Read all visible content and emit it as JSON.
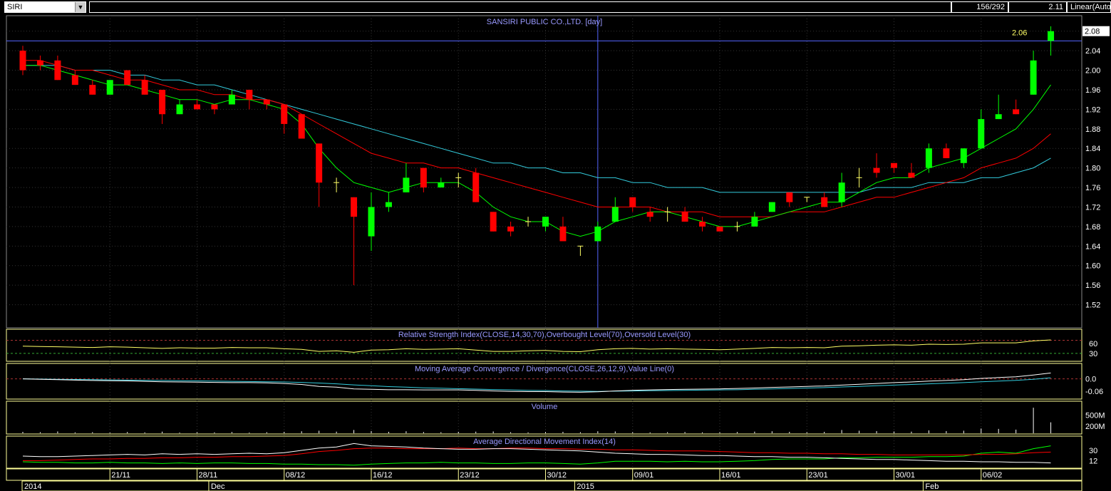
{
  "toolbar": {
    "symbol": "SIRI",
    "dropdown_glyph": "▼",
    "bar_counter": "156/292",
    "last_value": "2.11",
    "scale_mode": "Linear(Auto"
  },
  "colors": {
    "background": "#000000",
    "bull_candle": "#00ff00",
    "bear_candle": "#ff0000",
    "ma_short": "#00ff00",
    "ma_mid": "#ff0000",
    "ma_long": "#33ccdd",
    "crosshair": "#5566ff",
    "panel_border": "#ffff99",
    "rsi_line": "#ffff66",
    "macd_line": "#ffffff",
    "signal_line": "#33ccdd",
    "adx_line": "#ffffff",
    "dmi_plus": "#00ff00",
    "dmi_minus": "#ff0000"
  },
  "chart_data": [
    {
      "type": "candlestick",
      "title": "SANSIRI PUBLIC CO.,LTD. [day]",
      "crosshair_value": "2.06",
      "last_price_tag": "2.08",
      "ylim": [
        1.48,
        2.1
      ],
      "y_ticks": [
        "2.08",
        "2.04",
        "2.00",
        "1.96",
        "1.92",
        "1.88",
        "1.84",
        "1.80",
        "1.76",
        "1.72",
        "1.68",
        "1.64",
        "1.60",
        "1.56",
        "1.52"
      ],
      "x_tick_labels": [
        "21/11",
        "28/11",
        "08/12",
        "16/12",
        "23/12",
        "30/12",
        "09/01",
        "16/01",
        "23/01",
        "30/01",
        "06/02"
      ],
      "x_tick_index": [
        5,
        10,
        15,
        20,
        25,
        30,
        35,
        40,
        45,
        50,
        55
      ],
      "period_labels": [
        "2014",
        "Dec",
        "2015",
        "Feb"
      ],
      "period_index": [
        0,
        11,
        32,
        52
      ],
      "crosshair_index": 33,
      "ohlc": [
        [
          2.04,
          2.05,
          1.99,
          2.0
        ],
        [
          2.02,
          2.03,
          2.0,
          2.01
        ],
        [
          2.02,
          2.03,
          1.98,
          1.98
        ],
        [
          1.99,
          2.0,
          1.97,
          1.97
        ],
        [
          1.97,
          1.98,
          1.95,
          1.95
        ],
        [
          1.95,
          1.98,
          1.95,
          1.98
        ],
        [
          2.0,
          2.0,
          1.97,
          1.97
        ],
        [
          1.98,
          1.99,
          1.95,
          1.95
        ],
        [
          1.96,
          1.96,
          1.89,
          1.91
        ],
        [
          1.91,
          1.94,
          1.91,
          1.93
        ],
        [
          1.93,
          1.94,
          1.92,
          1.92
        ],
        [
          1.93,
          1.93,
          1.91,
          1.92
        ],
        [
          1.93,
          1.96,
          1.93,
          1.95
        ],
        [
          1.96,
          1.96,
          1.92,
          1.94
        ],
        [
          1.94,
          1.94,
          1.92,
          1.93
        ],
        [
          1.93,
          1.93,
          1.87,
          1.89
        ],
        [
          1.91,
          1.91,
          1.86,
          1.86
        ],
        [
          1.85,
          1.85,
          1.72,
          1.77
        ],
        [
          1.77,
          1.78,
          1.75,
          1.77
        ],
        [
          1.74,
          1.74,
          1.56,
          1.7
        ],
        [
          1.66,
          1.75,
          1.63,
          1.72
        ],
        [
          1.72,
          1.75,
          1.71,
          1.73
        ],
        [
          1.75,
          1.81,
          1.75,
          1.78
        ],
        [
          1.8,
          1.8,
          1.75,
          1.76
        ],
        [
          1.76,
          1.78,
          1.76,
          1.77
        ],
        [
          1.78,
          1.79,
          1.76,
          1.78
        ],
        [
          1.79,
          1.8,
          1.73,
          1.73
        ],
        [
          1.71,
          1.71,
          1.67,
          1.67
        ],
        [
          1.68,
          1.69,
          1.66,
          1.67
        ],
        [
          1.69,
          1.7,
          1.68,
          1.69
        ],
        [
          1.68,
          1.7,
          1.67,
          1.7
        ],
        [
          1.68,
          1.7,
          1.65,
          1.65
        ],
        [
          1.64,
          1.64,
          1.62,
          1.64
        ],
        [
          1.65,
          1.69,
          1.65,
          1.68
        ],
        [
          1.69,
          1.74,
          1.69,
          1.72
        ],
        [
          1.74,
          1.74,
          1.71,
          1.72
        ],
        [
          1.71,
          1.72,
          1.69,
          1.7
        ],
        [
          1.71,
          1.72,
          1.69,
          1.71
        ],
        [
          1.71,
          1.72,
          1.69,
          1.69
        ],
        [
          1.69,
          1.7,
          1.67,
          1.68
        ],
        [
          1.68,
          1.68,
          1.67,
          1.67
        ],
        [
          1.68,
          1.69,
          1.67,
          1.68
        ],
        [
          1.68,
          1.71,
          1.68,
          1.7
        ],
        [
          1.71,
          1.73,
          1.71,
          1.73
        ],
        [
          1.75,
          1.75,
          1.72,
          1.73
        ],
        [
          1.74,
          1.74,
          1.73,
          1.74
        ],
        [
          1.74,
          1.75,
          1.72,
          1.72
        ],
        [
          1.73,
          1.79,
          1.72,
          1.77
        ],
        [
          1.78,
          1.8,
          1.76,
          1.78
        ],
        [
          1.8,
          1.83,
          1.78,
          1.79
        ],
        [
          1.81,
          1.81,
          1.79,
          1.8
        ],
        [
          1.79,
          1.81,
          1.78,
          1.78
        ],
        [
          1.8,
          1.85,
          1.79,
          1.84
        ],
        [
          1.84,
          1.85,
          1.82,
          1.82
        ],
        [
          1.81,
          1.84,
          1.8,
          1.84
        ],
        [
          1.84,
          1.92,
          1.84,
          1.9
        ],
        [
          1.9,
          1.95,
          1.9,
          1.91
        ],
        [
          1.92,
          1.94,
          1.91,
          1.91
        ],
        [
          1.95,
          2.04,
          1.95,
          2.02
        ],
        [
          2.06,
          2.09,
          2.03,
          2.08
        ]
      ],
      "ma_short": [
        2.01,
        2.01,
        2.0,
        1.99,
        1.98,
        1.97,
        1.97,
        1.96,
        1.95,
        1.94,
        1.94,
        1.93,
        1.94,
        1.94,
        1.93,
        1.92,
        1.89,
        1.84,
        1.8,
        1.77,
        1.76,
        1.75,
        1.76,
        1.77,
        1.77,
        1.77,
        1.75,
        1.72,
        1.7,
        1.69,
        1.69,
        1.67,
        1.66,
        1.67,
        1.69,
        1.7,
        1.71,
        1.71,
        1.7,
        1.69,
        1.68,
        1.68,
        1.69,
        1.7,
        1.71,
        1.72,
        1.73,
        1.73,
        1.75,
        1.77,
        1.78,
        1.78,
        1.8,
        1.81,
        1.82,
        1.84,
        1.86,
        1.88,
        1.92,
        1.97
      ],
      "ma_mid": [
        2.02,
        2.02,
        2.01,
        2.0,
        2.0,
        1.99,
        1.98,
        1.98,
        1.97,
        1.96,
        1.96,
        1.95,
        1.95,
        1.94,
        1.94,
        1.93,
        1.91,
        1.89,
        1.87,
        1.85,
        1.83,
        1.82,
        1.81,
        1.81,
        1.8,
        1.8,
        1.79,
        1.78,
        1.77,
        1.76,
        1.75,
        1.74,
        1.73,
        1.72,
        1.72,
        1.72,
        1.72,
        1.71,
        1.71,
        1.71,
        1.7,
        1.7,
        1.7,
        1.7,
        1.71,
        1.71,
        1.71,
        1.72,
        1.73,
        1.74,
        1.74,
        1.75,
        1.76,
        1.77,
        1.78,
        1.8,
        1.81,
        1.82,
        1.84,
        1.87
      ],
      "ma_long": [
        2.01,
        2.01,
        2.01,
        2.0,
        2.0,
        2.0,
        1.99,
        1.99,
        1.98,
        1.98,
        1.97,
        1.97,
        1.96,
        1.95,
        1.94,
        1.93,
        1.92,
        1.91,
        1.9,
        1.89,
        1.88,
        1.87,
        1.86,
        1.85,
        1.84,
        1.83,
        1.82,
        1.81,
        1.81,
        1.8,
        1.8,
        1.79,
        1.79,
        1.78,
        1.78,
        1.77,
        1.77,
        1.76,
        1.76,
        1.76,
        1.75,
        1.75,
        1.75,
        1.75,
        1.75,
        1.75,
        1.75,
        1.75,
        1.75,
        1.76,
        1.76,
        1.76,
        1.77,
        1.77,
        1.77,
        1.78,
        1.78,
        1.79,
        1.8,
        1.82
      ]
    },
    {
      "type": "line",
      "title": "Relative Strength Index(CLOSE,14,30,70),Overbought Level(70),Oversold Level(30)",
      "y_ticks": [
        "60",
        "30"
      ],
      "ylim": [
        10,
        95
      ],
      "levels": [
        70,
        30
      ],
      "values": [
        52,
        51,
        50,
        49,
        48,
        50,
        49,
        47,
        45,
        47,
        46,
        46,
        48,
        47,
        47,
        44,
        42,
        36,
        38,
        33,
        40,
        41,
        44,
        42,
        43,
        44,
        40,
        36,
        36,
        38,
        39,
        36,
        35,
        41,
        44,
        45,
        43,
        44,
        43,
        42,
        41,
        43,
        45,
        48,
        47,
        48,
        47,
        52,
        53,
        55,
        56,
        55,
        58,
        57,
        58,
        62,
        62,
        62,
        68,
        71
      ]
    },
    {
      "type": "line",
      "title": "Moving Average Convergence / Divergence(CLOSE,26,12,9),Value Line(0)",
      "y_ticks": [
        "0.0",
        "-0.06"
      ],
      "ylim": [
        -0.09,
        0.06
      ],
      "series": [
        {
          "values": [
            0.0,
            -0.002,
            -0.004,
            -0.006,
            -0.008,
            -0.009,
            -0.01,
            -0.012,
            -0.014,
            -0.015,
            -0.016,
            -0.017,
            -0.018,
            -0.018,
            -0.019,
            -0.022,
            -0.027,
            -0.036,
            -0.04,
            -0.048,
            -0.05,
            -0.052,
            -0.052,
            -0.053,
            -0.053,
            -0.053,
            -0.055,
            -0.058,
            -0.06,
            -0.061,
            -0.061,
            -0.063,
            -0.064,
            -0.062,
            -0.058,
            -0.055,
            -0.053,
            -0.051,
            -0.05,
            -0.049,
            -0.048,
            -0.046,
            -0.044,
            -0.041,
            -0.039,
            -0.036,
            -0.034,
            -0.03,
            -0.026,
            -0.022,
            -0.018,
            -0.015,
            -0.011,
            -0.008,
            -0.004,
            0.002,
            0.006,
            0.01,
            0.018,
            0.028
          ]
        },
        {
          "values": [
            0.0,
            -0.001,
            -0.002,
            -0.003,
            -0.004,
            -0.005,
            -0.006,
            -0.007,
            -0.008,
            -0.009,
            -0.01,
            -0.011,
            -0.012,
            -0.013,
            -0.014,
            -0.015,
            -0.017,
            -0.02,
            -0.024,
            -0.029,
            -0.033,
            -0.037,
            -0.04,
            -0.043,
            -0.045,
            -0.047,
            -0.049,
            -0.051,
            -0.053,
            -0.055,
            -0.056,
            -0.058,
            -0.059,
            -0.06,
            -0.059,
            -0.058,
            -0.057,
            -0.056,
            -0.055,
            -0.054,
            -0.053,
            -0.052,
            -0.05,
            -0.048,
            -0.046,
            -0.044,
            -0.042,
            -0.039,
            -0.036,
            -0.033,
            -0.03,
            -0.027,
            -0.024,
            -0.021,
            -0.018,
            -0.014,
            -0.011,
            -0.007,
            -0.002,
            0.005
          ]
        }
      ]
    },
    {
      "type": "bar",
      "title": "Volume",
      "y_ticks": [
        "500M",
        "200M"
      ],
      "ylim": [
        0,
        800
      ],
      "values": [
        40,
        30,
        50,
        25,
        30,
        20,
        35,
        25,
        45,
        20,
        30,
        25,
        35,
        20,
        30,
        40,
        55,
        70,
        45,
        90,
        60,
        40,
        55,
        35,
        30,
        40,
        45,
        50,
        30,
        25,
        35,
        40,
        30,
        55,
        50,
        30,
        25,
        30,
        35,
        25,
        30,
        35,
        45,
        55,
        40,
        30,
        40,
        90,
        70,
        60,
        50,
        45,
        80,
        60,
        70,
        130,
        120,
        100,
        700,
        300
      ]
    },
    {
      "type": "line",
      "title": "Average Directional Movement Index(14)",
      "y_ticks": [
        "30",
        "12"
      ],
      "ylim": [
        0,
        50
      ],
      "series": [
        {
          "values": [
            20,
            19,
            19,
            20,
            21,
            22,
            23,
            22,
            24,
            23,
            24,
            23,
            24,
            25,
            24,
            26,
            30,
            34,
            36,
            42,
            38,
            37,
            36,
            34,
            33,
            32,
            32,
            33,
            33,
            32,
            31,
            30,
            29,
            27,
            25,
            24,
            23,
            23,
            22,
            21,
            21,
            20,
            19,
            19,
            18,
            18,
            17,
            16,
            15,
            14,
            14,
            13,
            12,
            11,
            11,
            10,
            10,
            9,
            9,
            8
          ]
        },
        {
          "values": [
            12,
            12,
            13,
            14,
            15,
            15,
            16,
            16,
            17,
            17,
            18,
            18,
            19,
            19,
            20,
            21,
            24,
            28,
            30,
            33,
            34,
            34,
            33,
            33,
            33,
            34,
            33,
            33,
            34,
            34,
            33,
            33,
            32,
            32,
            31,
            31,
            30,
            29,
            29,
            29,
            28,
            27,
            26,
            26,
            25,
            25,
            24,
            24,
            23,
            23,
            22,
            22,
            22,
            22,
            22,
            23,
            23,
            24,
            26,
            27
          ]
        },
        {
          "values": [
            10,
            9,
            9,
            8,
            8,
            9,
            8,
            8,
            7,
            8,
            7,
            8,
            8,
            7,
            7,
            6,
            6,
            5,
            5,
            4,
            6,
            7,
            8,
            8,
            9,
            8,
            8,
            7,
            7,
            8,
            8,
            7,
            6,
            8,
            11,
            11,
            11,
            10,
            11,
            10,
            10,
            11,
            12,
            14,
            15,
            15,
            15,
            17,
            17,
            18,
            18,
            18,
            19,
            19,
            20,
            25,
            27,
            25,
            33,
            38
          ]
        }
      ]
    }
  ]
}
